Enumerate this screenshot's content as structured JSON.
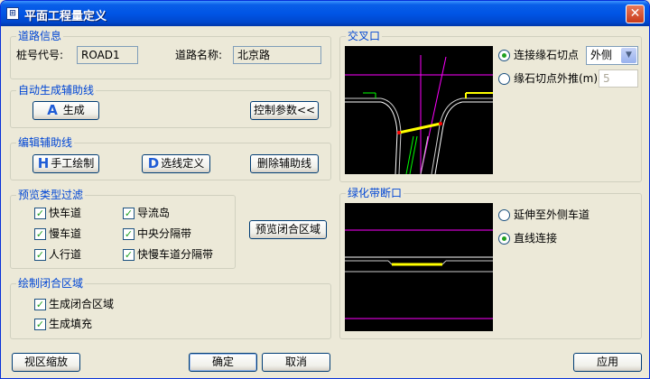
{
  "window": {
    "title": "平面工程量定义",
    "icon_char": "⊞"
  },
  "road_info": {
    "title": "道路信息",
    "pile_label": "桩号代号:",
    "pile_value": "ROAD1",
    "name_label": "道路名称:",
    "name_value": "北京路"
  },
  "auto_gen": {
    "title": "自动生成辅助线",
    "generate_icon": "A",
    "generate_label": "生成",
    "params_label": "控制参数<<"
  },
  "edit_aux": {
    "title": "编辑辅助线",
    "manual_icon": "H",
    "manual_label": "手工绘制",
    "select_icon": "D",
    "select_label": "选线定义",
    "delete_label": "删除辅助线"
  },
  "filter": {
    "title": "预览类型过滤",
    "items": [
      {
        "label": "快车道",
        "checked": true
      },
      {
        "label": "导流岛",
        "checked": true
      },
      {
        "label": "慢车道",
        "checked": true
      },
      {
        "label": "中央分隔带",
        "checked": true
      },
      {
        "label": "人行道",
        "checked": true
      },
      {
        "label": "快慢车道分隔带",
        "checked": true
      }
    ],
    "preview_button": "预览闭合区域"
  },
  "draw_closed": {
    "title": "绘制闭合区域",
    "items": [
      {
        "label": "生成闭合区域",
        "checked": true
      },
      {
        "label": "生成填充",
        "checked": true
      }
    ]
  },
  "intersection": {
    "title": "交叉口",
    "radio1_label": "连接缘石切点",
    "radio1_selected": true,
    "select_value": "外侧",
    "radio2_label": "缘石切点外推(m)",
    "radio2_selected": false,
    "offset_value": "5"
  },
  "green_belt": {
    "title": "绿化带断口",
    "radio1_label": "延伸至外侧车道",
    "radio1_selected": false,
    "radio2_label": "直线连接",
    "radio2_selected": true
  },
  "bottom": {
    "zoom_label": "视区缩放",
    "ok_label": "确定",
    "cancel_label": "取消",
    "apply_label": "应用"
  },
  "check_mark": "✓",
  "colors": {
    "title_bar": "#0055E5",
    "group_title": "#0046D5",
    "check_green": "#21A121",
    "preview_bg": "#000000",
    "magenta_line": "#FF00FF",
    "yellow_line": "#FFFF00"
  }
}
